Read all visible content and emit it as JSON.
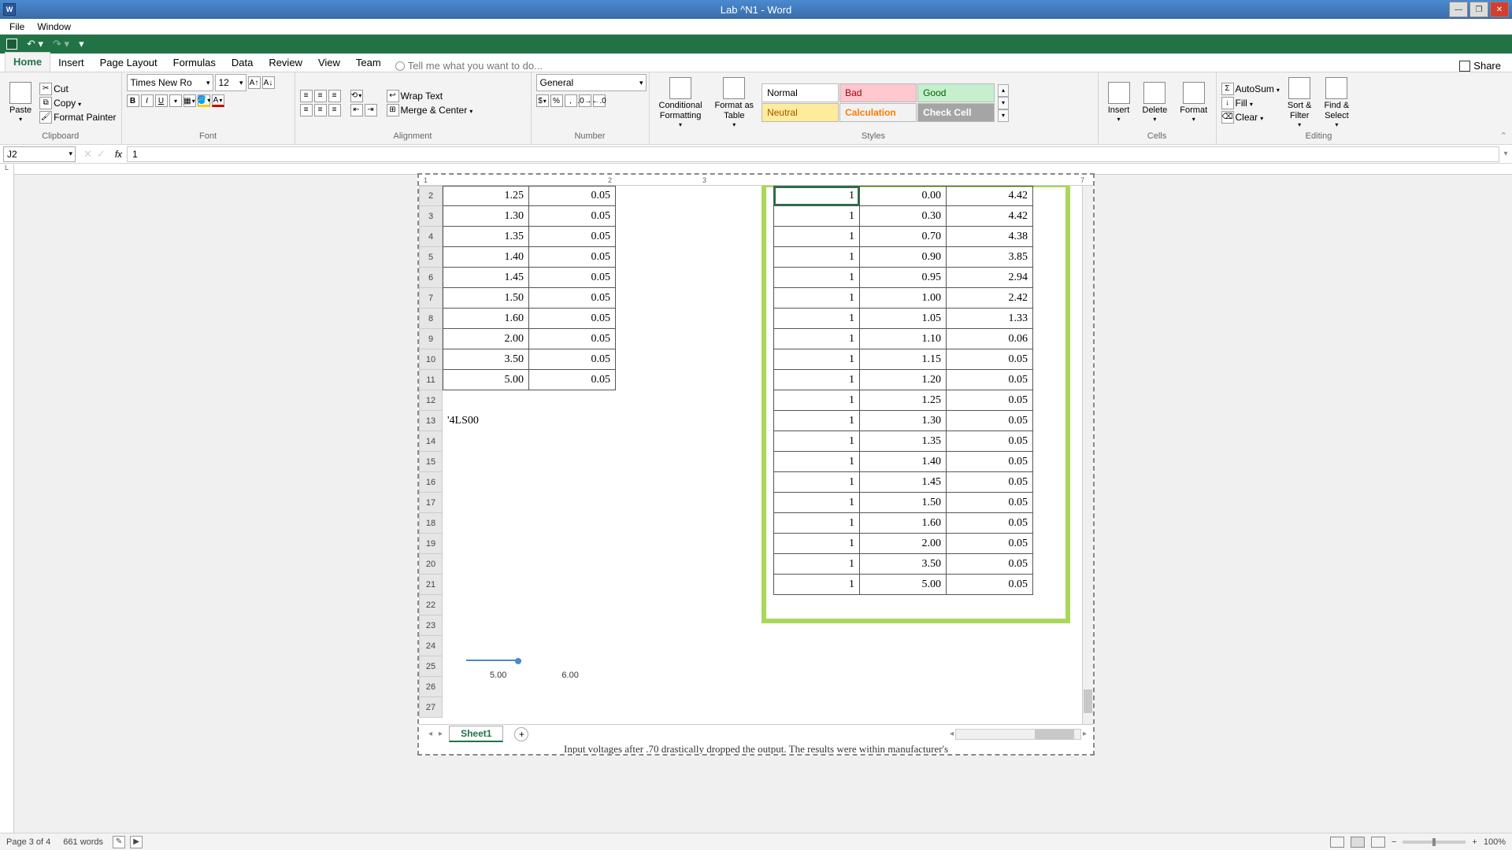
{
  "title": "Lab ^N1 - Word",
  "menubar": [
    "File",
    "Window"
  ],
  "tabs": {
    "items": [
      "Home",
      "Insert",
      "Page Layout",
      "Formulas",
      "Data",
      "Review",
      "View",
      "Team"
    ],
    "tellme": "Tell me what you want to do...",
    "share": "Share"
  },
  "ribbon": {
    "clipboard": {
      "paste": "Paste",
      "cut": "Cut",
      "copy": "Copy",
      "fp": "Format Painter",
      "label": "Clipboard"
    },
    "font": {
      "name": "Times New Ro",
      "size": "12",
      "label": "Font"
    },
    "alignment": {
      "wrap": "Wrap Text",
      "merge": "Merge & Center",
      "label": "Alignment"
    },
    "number": {
      "format": "General",
      "label": "Number"
    },
    "styles": {
      "cf": "Conditional\nFormatting",
      "fat": "Format as\nTable",
      "normal": "Normal",
      "bad": "Bad",
      "good": "Good",
      "neutral": "Neutral",
      "calc": "Calculation",
      "check": "Check Cell",
      "label": "Styles"
    },
    "cells": {
      "insert": "Insert",
      "delete": "Delete",
      "format": "Format",
      "label": "Cells"
    },
    "editing": {
      "autosum": "AutoSum",
      "fill": "Fill",
      "clear": "Clear",
      "sort": "Sort &\nFilter",
      "find": "Find &\nSelect",
      "label": "Editing"
    }
  },
  "formula_bar": {
    "name_box": "J2",
    "value": "1"
  },
  "ruler_ticks": [
    "1",
    "2",
    "3",
    "7"
  ],
  "left_table": {
    "rows": [
      {
        "n": "2",
        "a": "1.25",
        "b": "0.05"
      },
      {
        "n": "3",
        "a": "1.30",
        "b": "0.05"
      },
      {
        "n": "4",
        "a": "1.35",
        "b": "0.05"
      },
      {
        "n": "5",
        "a": "1.40",
        "b": "0.05"
      },
      {
        "n": "6",
        "a": "1.45",
        "b": "0.05"
      },
      {
        "n": "7",
        "a": "1.50",
        "b": "0.05"
      },
      {
        "n": "8",
        "a": "1.60",
        "b": "0.05"
      },
      {
        "n": "9",
        "a": "2.00",
        "b": "0.05"
      },
      {
        "n": "10",
        "a": "3.50",
        "b": "0.05"
      },
      {
        "n": "11",
        "a": "5.00",
        "b": "0.05"
      }
    ]
  },
  "extra_rows": [
    "12",
    "13",
    "14",
    "15",
    "16",
    "17",
    "18",
    "19",
    "20",
    "21",
    "22",
    "23",
    "24",
    "25",
    "26",
    "27"
  ],
  "row13_text": "'4LS00",
  "right_table": {
    "rows": [
      {
        "a": "1",
        "b": "0.00",
        "c": "4.42"
      },
      {
        "a": "1",
        "b": "0.30",
        "c": "4.42"
      },
      {
        "a": "1",
        "b": "0.70",
        "c": "4.38"
      },
      {
        "a": "1",
        "b": "0.90",
        "c": "3.85"
      },
      {
        "a": "1",
        "b": "0.95",
        "c": "2.94"
      },
      {
        "a": "1",
        "b": "1.00",
        "c": "2.42"
      },
      {
        "a": "1",
        "b": "1.05",
        "c": "1.33"
      },
      {
        "a": "1",
        "b": "1.10",
        "c": "0.06"
      },
      {
        "a": "1",
        "b": "1.15",
        "c": "0.05"
      },
      {
        "a": "1",
        "b": "1.20",
        "c": "0.05"
      },
      {
        "a": "1",
        "b": "1.25",
        "c": "0.05"
      },
      {
        "a": "1",
        "b": "1.30",
        "c": "0.05"
      },
      {
        "a": "1",
        "b": "1.35",
        "c": "0.05"
      },
      {
        "a": "1",
        "b": "1.40",
        "c": "0.05"
      },
      {
        "a": "1",
        "b": "1.45",
        "c": "0.05"
      },
      {
        "a": "1",
        "b": "1.50",
        "c": "0.05"
      },
      {
        "a": "1",
        "b": "1.60",
        "c": "0.05"
      },
      {
        "a": "1",
        "b": "2.00",
        "c": "0.05"
      },
      {
        "a": "1",
        "b": "3.50",
        "c": "0.05"
      },
      {
        "a": "1",
        "b": "5.00",
        "c": "0.05"
      }
    ]
  },
  "chart_axis": {
    "a": "5.00",
    "b": "6.00"
  },
  "sheet_tab": "Sheet1",
  "bottom_text": "Input voltages after .70 drastically dropped the output. The results were within manufacturer's",
  "status": {
    "page": "Page 3 of 4",
    "words": "661 words",
    "zoom": "100%"
  }
}
